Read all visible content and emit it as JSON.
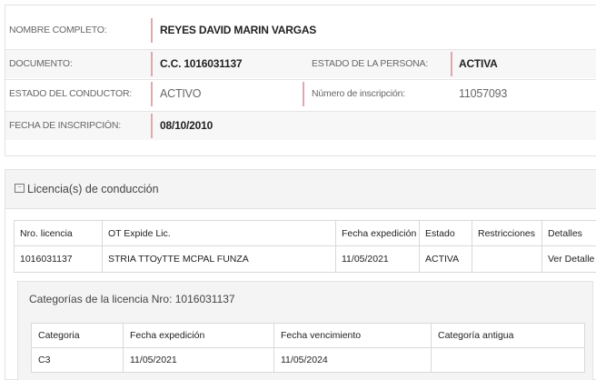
{
  "persona": {
    "nombre_label": "NOMBRE COMPLETO:",
    "nombre_value": "REYES DAVID MARIN VARGAS",
    "documento_label": "DOCUMENTO:",
    "documento_value": "C.C. 1016031137",
    "estado_persona_label": "ESTADO DE LA PERSONA:",
    "estado_persona_value": "ACTIVA",
    "estado_conductor_label": "ESTADO DEL CONDUCTOR:",
    "estado_conductor_value": "ACTIVO",
    "inscripcion_num_label": "Número de inscripción:",
    "inscripcion_num_value": "11057093",
    "fecha_inscripcion_label": "FECHA DE INSCRIPCIÓN:",
    "fecha_inscripcion_value": "08/10/2010"
  },
  "licencias": {
    "panel_title": "Licencia(s) de conducción",
    "headers": [
      "Nro. licencia",
      "OT Expide Lic.",
      "Fecha expedición",
      "Estado",
      "Restricciones",
      "Detalles"
    ],
    "rows": [
      {
        "nro": "1016031137",
        "ot": "STRIA TTOyTTE MCPAL FUNZA",
        "fecha": "11/05/2021",
        "estado": "ACTIVA",
        "restricciones": "",
        "detalles": "Ver Detalle"
      }
    ]
  },
  "categorias": {
    "title": "Categorías de la licencia Nro: 1016031137",
    "headers": [
      "Categoria",
      "Fecha expedición",
      "Fecha vencimiento",
      "Categoría antigua"
    ],
    "rows": [
      {
        "categoria": "C3",
        "expedicion": "11/05/2021",
        "vencimiento": "11/05/2024",
        "antigua": ""
      }
    ]
  },
  "colors": {
    "divider": "#e2a6ae",
    "panel_header": "#f4f4f4"
  },
  "icons": {
    "panel_icon": "collapse-icon"
  }
}
